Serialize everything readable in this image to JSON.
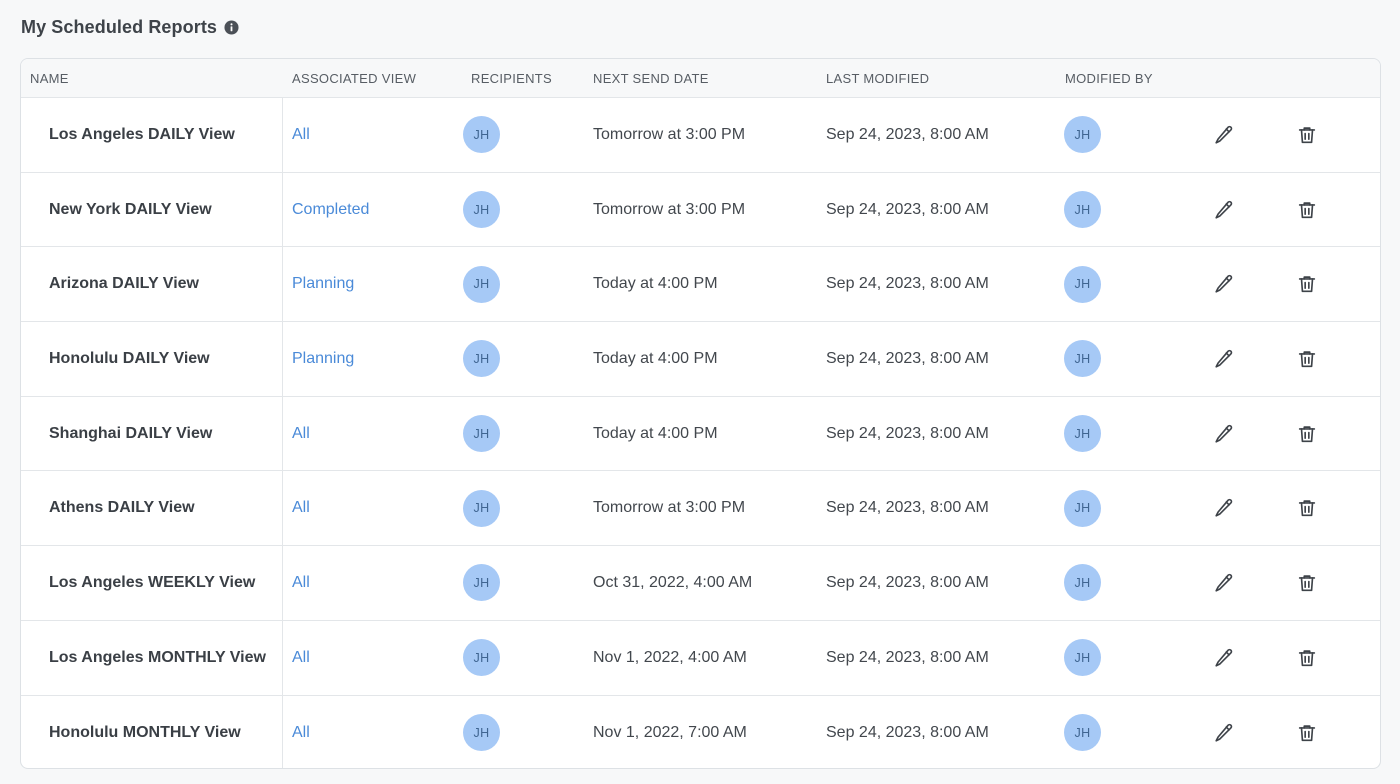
{
  "page": {
    "title": "My Scheduled Reports",
    "info_icon": "info-icon"
  },
  "table": {
    "columns": [
      "NAME",
      "ASSOCIATED VIEW",
      "RECIPIENTS",
      "NEXT SEND DATE",
      "LAST MODIFIED",
      "MODIFIED BY"
    ],
    "row_actions": [
      "pencil-icon",
      "trash-icon"
    ],
    "rows": [
      {
        "name": "Los Angeles DAILY View",
        "view": "All",
        "recipient": "JH",
        "next_send": "Tomorrow at 3:00 PM",
        "last_modified": "Sep 24, 2023, 8:00 AM",
        "modified_by": "JH"
      },
      {
        "name": "New York DAILY View",
        "view": "Completed",
        "recipient": "JH",
        "next_send": "Tomorrow at 3:00 PM",
        "last_modified": "Sep 24, 2023, 8:00 AM",
        "modified_by": "JH"
      },
      {
        "name": "Arizona DAILY View",
        "view": "Planning",
        "recipient": "JH",
        "next_send": "Today at 4:00 PM",
        "last_modified": "Sep 24, 2023, 8:00 AM",
        "modified_by": "JH"
      },
      {
        "name": "Honolulu DAILY View",
        "view": "Planning",
        "recipient": "JH",
        "next_send": "Today at 4:00 PM",
        "last_modified": "Sep 24, 2023, 8:00 AM",
        "modified_by": "JH"
      },
      {
        "name": "Shanghai DAILY View",
        "view": "All",
        "recipient": "JH",
        "next_send": "Today at 4:00 PM",
        "last_modified": "Sep 24, 2023, 8:00 AM",
        "modified_by": "JH"
      },
      {
        "name": "Athens DAILY View",
        "view": "All",
        "recipient": "JH",
        "next_send": "Tomorrow at 3:00 PM",
        "last_modified": "Sep 24, 2023, 8:00 AM",
        "modified_by": "JH"
      },
      {
        "name": "Los Angeles WEEKLY View",
        "view": "All",
        "recipient": "JH",
        "next_send": "Oct 31, 2022, 4:00 AM",
        "last_modified": "Sep 24, 2023, 8:00 AM",
        "modified_by": "JH"
      },
      {
        "name": "Los Angeles MONTHLY View",
        "view": "All",
        "recipient": "JH",
        "next_send": "Nov 1, 2022, 4:00 AM",
        "last_modified": "Sep 24, 2023, 8:00 AM",
        "modified_by": "JH"
      },
      {
        "name": "Honolulu MONTHLY View",
        "view": "All",
        "recipient": "JH",
        "next_send": "Nov 1, 2022, 7:00 AM",
        "last_modified": "Sep 24, 2023, 8:00 AM",
        "modified_by": "JH"
      }
    ]
  },
  "colors": {
    "link": "#4a8ad8",
    "avatar_bg": "#a6c9f6",
    "avatar_text": "#3f6591"
  }
}
